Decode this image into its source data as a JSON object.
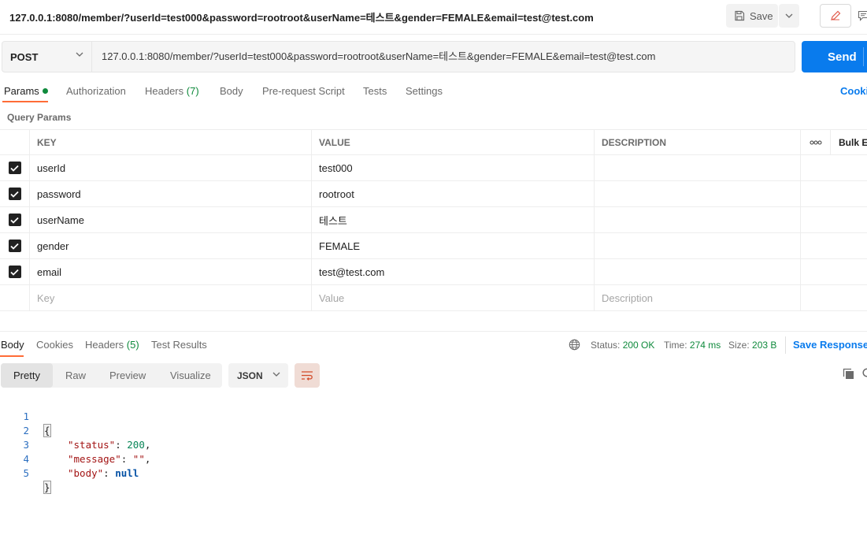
{
  "request": {
    "title": "127.0.0.1:8080/member/?userId=test000&password=rootroot&userName=테스트&gender=FEMALE&email=test@test.com",
    "method": "POST",
    "url": "127.0.0.1:8080/member/?userId=test000&password=rootroot&userName=테스트&gender=FEMALE&email=test@test.com",
    "save_label": "Save",
    "send_label": "Send"
  },
  "req_tabs": [
    {
      "label": "Params",
      "count": ""
    },
    {
      "label": "Authorization",
      "count": ""
    },
    {
      "label": "Headers",
      "count": "(7)"
    },
    {
      "label": "Body",
      "count": ""
    },
    {
      "label": "Pre-request Script",
      "count": ""
    },
    {
      "label": "Tests",
      "count": ""
    },
    {
      "label": "Settings",
      "count": ""
    }
  ],
  "cookies_link": "Cooki",
  "query_params": {
    "title": "Query Params",
    "headers": {
      "key": "KEY",
      "value": "VALUE",
      "description": "DESCRIPTION",
      "more": "ooo",
      "bulk": "Bulk E"
    },
    "rows": [
      {
        "key": "userId",
        "value": "test000",
        "description": ""
      },
      {
        "key": "password",
        "value": "rootroot",
        "description": ""
      },
      {
        "key": "userName",
        "value": "테스트",
        "description": ""
      },
      {
        "key": "gender",
        "value": "FEMALE",
        "description": ""
      },
      {
        "key": "email",
        "value": "test@test.com",
        "description": ""
      }
    ],
    "placeholders": {
      "key": "Key",
      "value": "Value",
      "description": "Description"
    }
  },
  "response": {
    "tabs": [
      {
        "label": "Body",
        "count": ""
      },
      {
        "label": "Cookies",
        "count": ""
      },
      {
        "label": "Headers",
        "count": "(5)"
      },
      {
        "label": "Test Results",
        "count": ""
      }
    ],
    "status_label": "Status:",
    "status_value": "200 OK",
    "time_label": "Time:",
    "time_value": "274 ms",
    "size_label": "Size:",
    "size_value": "203 B",
    "save_response": "Save Response",
    "view_tabs": [
      "Pretty",
      "Raw",
      "Preview",
      "Visualize"
    ],
    "format": "JSON",
    "code_lines": [
      {
        "n": "1"
      },
      {
        "n": "2",
        "key": "\"status\"",
        "value": "200",
        "trail": ","
      },
      {
        "n": "3",
        "key": "\"message\"",
        "value": "\"\"",
        "trail": ","
      },
      {
        "n": "4",
        "key": "\"body\"",
        "value": "null",
        "trail": ""
      },
      {
        "n": "5"
      }
    ],
    "open_brace": "{",
    "close_brace": "}"
  },
  "colors": {
    "accent": "#ff6c37",
    "send": "#097bed",
    "success": "#0f8a3c"
  }
}
